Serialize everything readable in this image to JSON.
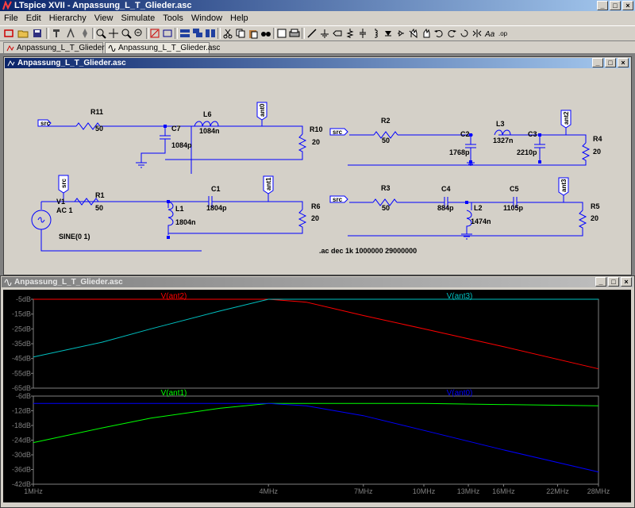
{
  "app": {
    "title": "LTspice XVII - Anpassung_L_T_Glieder.asc"
  },
  "menu": [
    "File",
    "Edit",
    "Hierarchy",
    "View",
    "Simulate",
    "Tools",
    "Window",
    "Help"
  ],
  "tabs": [
    {
      "label": "Anpassung_L_T_Glieder.asc",
      "active": false
    },
    {
      "label": "Anpassung_L_T_Glieder.asc",
      "active": true
    }
  ],
  "schematic": {
    "window_title": "Anpassung_L_T_Glieder.asc",
    "directive": ".ac dec 1k 1000000 29000000",
    "source": {
      "name": "V1",
      "value": "AC 1",
      "func": "SINE(0 1)"
    },
    "flags": {
      "src": "src",
      "ant0": "ant0",
      "ant1": "ant1",
      "ant2": "ant2",
      "ant3": "ant3"
    },
    "components": {
      "R11": {
        "name": "R11",
        "value": "50"
      },
      "C7": {
        "name": "C7",
        "value": "1084p"
      },
      "L6": {
        "name": "L6",
        "value": "1084n"
      },
      "R10": {
        "name": "R10",
        "value": "20"
      },
      "R1": {
        "name": "R1",
        "value": "50"
      },
      "L1": {
        "name": "L1",
        "value": "1804n"
      },
      "C1": {
        "name": "C1",
        "value": "1804p"
      },
      "R6": {
        "name": "R6",
        "value": "20"
      },
      "R2": {
        "name": "R2",
        "value": "50"
      },
      "C2": {
        "name": "C2",
        "value": "1768p"
      },
      "L3": {
        "name": "L3",
        "value": "1327n"
      },
      "C3": {
        "name": "C3",
        "value": "2210p"
      },
      "R4": {
        "name": "R4",
        "value": "20"
      },
      "R3": {
        "name": "R3",
        "value": "50"
      },
      "C4": {
        "name": "C4",
        "value": "884p"
      },
      "L2": {
        "name": "L2",
        "value": "1474n"
      },
      "C5": {
        "name": "C5",
        "value": "1105p"
      },
      "R5": {
        "name": "R5",
        "value": "20"
      }
    }
  },
  "plot_window": {
    "window_title": "Anpassung_L_T_Glieder.asc"
  },
  "chart_data": [
    {
      "type": "line",
      "x_scale": "log",
      "xlim": [
        1000000,
        28000000
      ],
      "ylim": [
        -65,
        -5
      ],
      "yticks": [
        "-5dB",
        "-15dB",
        "-25dB",
        "-35dB",
        "-45dB",
        "-55dB",
        "-65dB"
      ],
      "series": [
        {
          "name": "V(ant2)",
          "color": "#ff0000",
          "x": [
            1000000,
            2000000,
            3000000,
            4000000,
            5000000,
            7000000,
            10000000,
            16000000,
            28000000
          ],
          "values": [
            -5,
            -5,
            -5,
            -5,
            -7,
            -16,
            -25,
            -37,
            -52
          ]
        },
        {
          "name": "V(ant3)",
          "color": "#00c0c0",
          "x": [
            1000000,
            1500000,
            2000000,
            3000000,
            4000000,
            5000000,
            10000000,
            28000000
          ],
          "values": [
            -44,
            -34,
            -25,
            -13,
            -5,
            -5,
            -5,
            -5
          ]
        }
      ]
    },
    {
      "type": "line",
      "x_scale": "log",
      "xlim": [
        1000000,
        28000000
      ],
      "ylim": [
        -42,
        -6
      ],
      "yticks": [
        "-6dB",
        "-12dB",
        "-18dB",
        "-24dB",
        "-30dB",
        "-36dB",
        "-42dB"
      ],
      "xticks": [
        "1MHz",
        "4MHz",
        "7MHz",
        "10MHz",
        "13MHz",
        "16MHz",
        "22MHz",
        "28MHz"
      ],
      "series": [
        {
          "name": "V(ant1)",
          "color": "#00ff00",
          "x": [
            1000000,
            1500000,
            2000000,
            3000000,
            4000000,
            5000000,
            10000000,
            28000000
          ],
          "values": [
            -25,
            -19,
            -15,
            -11,
            -9,
            -9,
            -9,
            -10
          ]
        },
        {
          "name": "V(ant0)",
          "color": "#0000ff",
          "x": [
            1000000,
            2000000,
            3000000,
            4000000,
            5000000,
            7000000,
            10000000,
            16000000,
            28000000
          ],
          "values": [
            -9,
            -9,
            -9,
            -9,
            -10,
            -14,
            -20,
            -28,
            -37
          ]
        }
      ]
    }
  ]
}
